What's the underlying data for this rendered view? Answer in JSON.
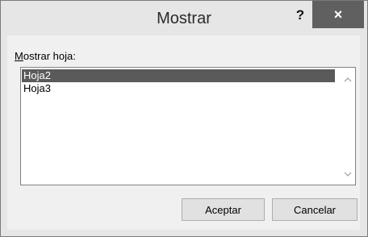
{
  "dialog": {
    "title": "Mostrar",
    "help_label": "?",
    "close_label": "×"
  },
  "list": {
    "label_mnemonic": "M",
    "label_rest": "ostrar hoja:",
    "items": [
      {
        "label": "Hoja2",
        "selected": true
      },
      {
        "label": "Hoja3",
        "selected": false
      }
    ],
    "scroll_up_icon": "chevron-up-icon",
    "scroll_down_icon": "chevron-down-icon"
  },
  "buttons": {
    "ok_label": "Aceptar",
    "cancel_label": "Cancelar"
  }
}
